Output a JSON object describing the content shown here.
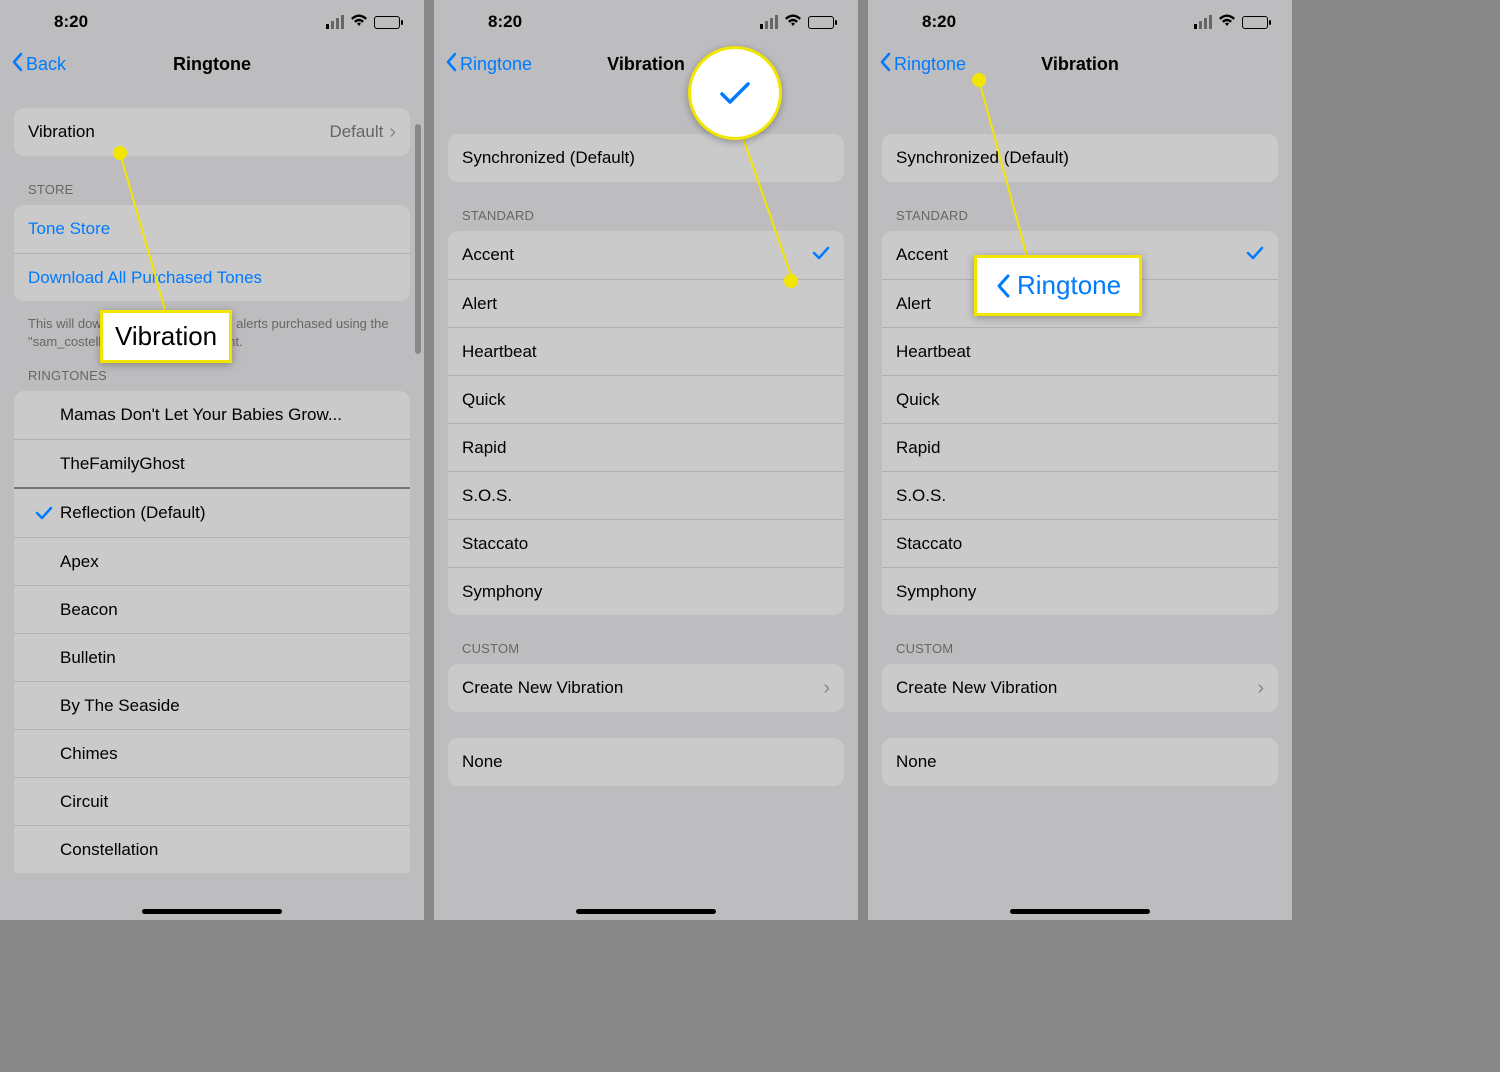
{
  "status": {
    "time": "8:20"
  },
  "screen1": {
    "back": "Back",
    "title": "Ringtone",
    "vibration_label": "Vibration",
    "vibration_value": "Default",
    "store_header": "STORE",
    "tone_store": "Tone Store",
    "download": "Download All Purchased Tones",
    "download_footnote": "This will download all ringtones and alerts purchased using the \"sam_costello@yahoo.com\" account.",
    "ringtones_header": "RINGTONES",
    "custom_tones": [
      "Mamas Don't Let Your Babies Grow...",
      "TheFamilyGhost"
    ],
    "selected": "Reflection (Default)",
    "tones": [
      "Apex",
      "Beacon",
      "Bulletin",
      "By The Seaside",
      "Chimes",
      "Circuit",
      "Constellation"
    ],
    "callout": "Vibration"
  },
  "screen2": {
    "back": "Ringtone",
    "title": "Vibration",
    "sync": "Synchronized (Default)",
    "standard_header": "STANDARD",
    "standard": [
      "Accent",
      "Alert",
      "Heartbeat",
      "Quick",
      "Rapid",
      "S.O.S.",
      "Staccato",
      "Symphony"
    ],
    "selected_index": 0,
    "custom_header": "CUSTOM",
    "create": "Create New Vibration",
    "none": "None"
  },
  "screen3": {
    "back": "Ringtone",
    "title": "Vibration",
    "sync": "Synchronized (Default)",
    "standard_header": "STANDARD",
    "standard": [
      "Accent",
      "Alert",
      "Heartbeat",
      "Quick",
      "Rapid",
      "S.O.S.",
      "Staccato",
      "Symphony"
    ],
    "selected_index": 0,
    "custom_header": "CUSTOM",
    "create": "Create New Vibration",
    "none": "None",
    "callout": "Ringtone"
  }
}
